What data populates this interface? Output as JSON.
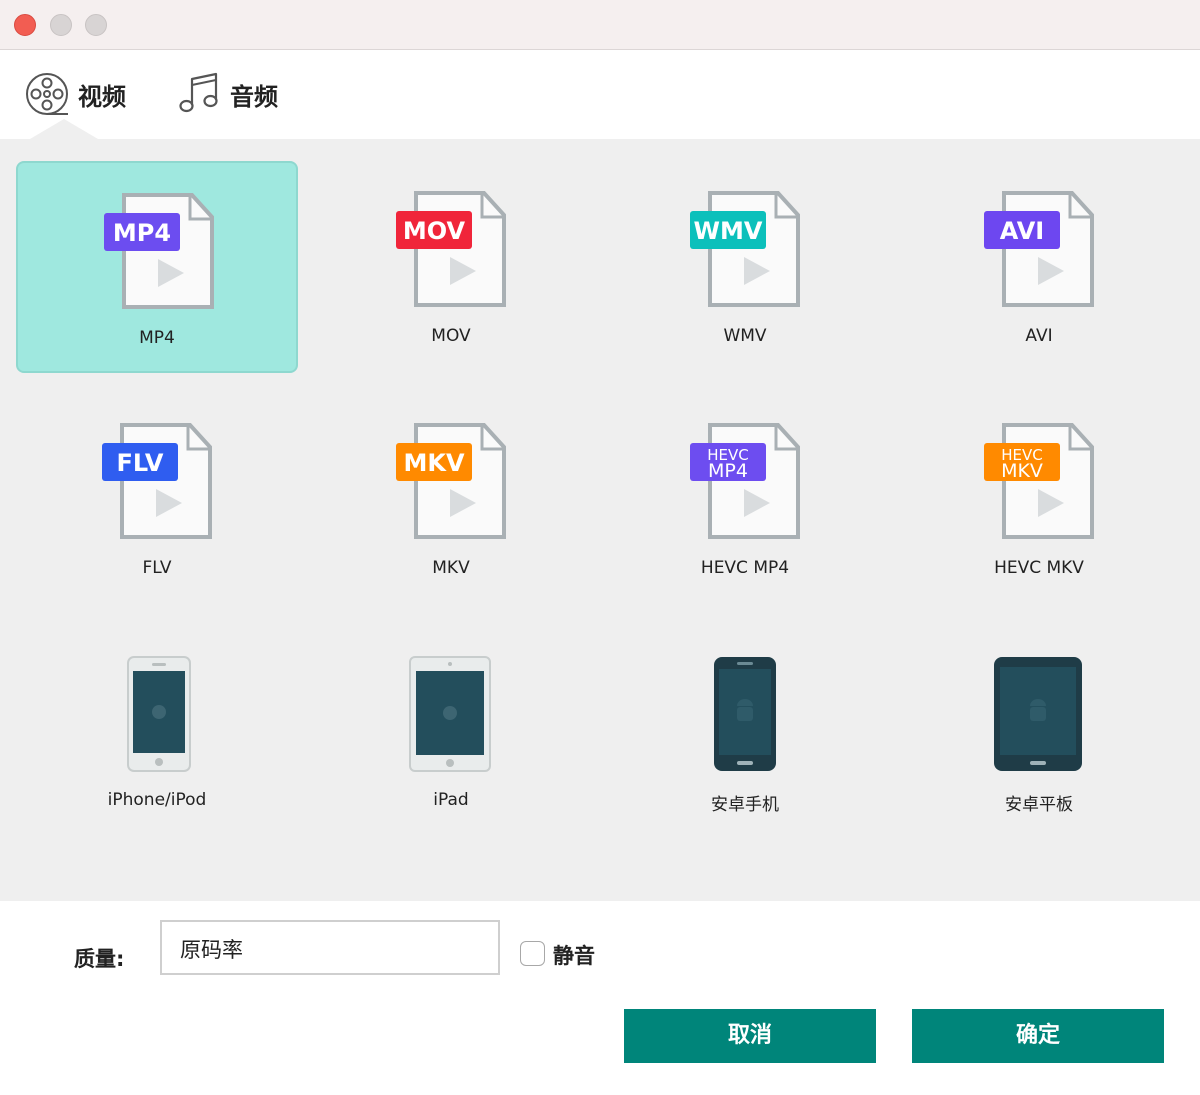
{
  "tabs": [
    {
      "label": "视频",
      "icon": "film-reel-icon",
      "active": true
    },
    {
      "label": "音频",
      "icon": "music-note-icon",
      "active": false
    }
  ],
  "formats": [
    {
      "label": "MP4",
      "badge": [
        "MP4"
      ],
      "color": "#6c4df0",
      "kind": "file",
      "selected": true
    },
    {
      "label": "MOV",
      "badge": [
        "MOV"
      ],
      "color": "#f0253a",
      "kind": "file"
    },
    {
      "label": "WMV",
      "badge": [
        "WMV"
      ],
      "color": "#0cc0bb",
      "kind": "file"
    },
    {
      "label": "AVI",
      "badge": [
        "AVI"
      ],
      "color": "#6d47f0",
      "kind": "file"
    },
    {
      "label": "FLV",
      "badge": [
        "FLV"
      ],
      "color": "#2f5df0",
      "kind": "file"
    },
    {
      "label": "MKV",
      "badge": [
        "MKV"
      ],
      "color": "#ff8a00",
      "kind": "file"
    },
    {
      "label": "HEVC MP4",
      "badge": [
        "HEVC",
        "MP4"
      ],
      "color": "#6d4df0",
      "kind": "file"
    },
    {
      "label": "HEVC MKV",
      "badge": [
        "HEVC",
        "MKV"
      ],
      "color": "#ff8a00",
      "kind": "file"
    },
    {
      "label": "iPhone/iPod",
      "kind": "phone",
      "device": "iphone"
    },
    {
      "label": "iPad",
      "kind": "tablet",
      "device": "ipad"
    },
    {
      "label": "安卓手机",
      "kind": "phone",
      "device": "android"
    },
    {
      "label": "安卓平板",
      "kind": "tablet",
      "device": "android"
    }
  ],
  "quality": {
    "label": "质量:",
    "value": "原码率"
  },
  "mute": {
    "label": "静音",
    "checked": false
  },
  "buttons": {
    "cancel": "取消",
    "ok": "确定"
  },
  "colors": {
    "accent": "#00857a",
    "selected_bg": "#9fe8df",
    "grid_bg": "#efefef"
  }
}
